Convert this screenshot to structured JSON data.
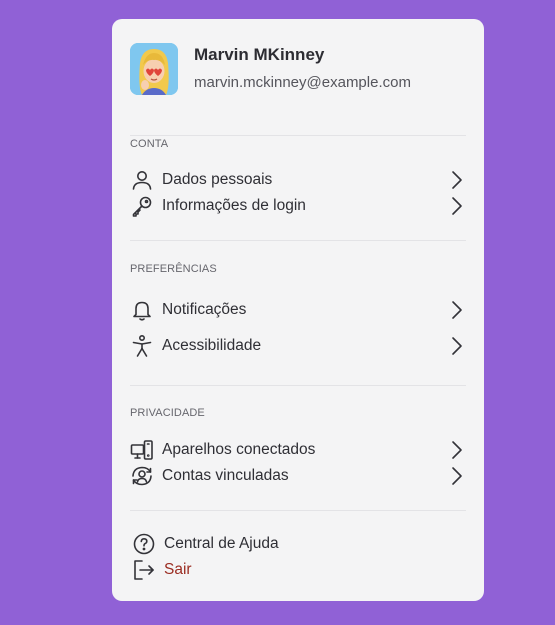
{
  "profile": {
    "name": "Marvin MKinney",
    "email": "marvin.mckinney@example.com"
  },
  "sections": {
    "conta": {
      "title": "CONTA",
      "items": [
        {
          "label": "Dados pessoais",
          "icon": "user-icon"
        },
        {
          "label": "Informações de login",
          "icon": "key-icon"
        }
      ]
    },
    "preferencias": {
      "title": "PREFERÊNCIAS",
      "items": [
        {
          "label": "Notificações",
          "icon": "bell-icon"
        },
        {
          "label": "Acessibilidade",
          "icon": "accessibility-icon"
        }
      ]
    },
    "privacidade": {
      "title": "PRIVACIDADE",
      "items": [
        {
          "label": "Aparelhos conectados",
          "icon": "devices-icon"
        },
        {
          "label": "Contas vinculadas",
          "icon": "linked-accounts-icon"
        }
      ]
    }
  },
  "footer": {
    "help_label": "Central de Ajuda",
    "logout_label": "Sair"
  },
  "colors": {
    "background": "#9061d6",
    "card": "#f4f4f5",
    "logout_text": "#9b2d22"
  }
}
